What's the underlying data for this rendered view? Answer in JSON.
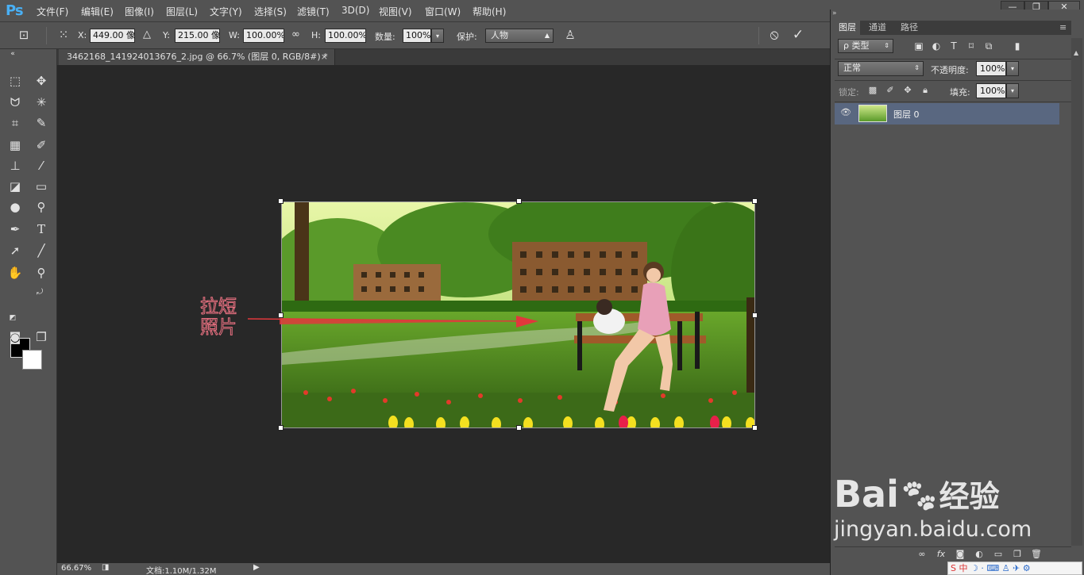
{
  "app": {
    "logo": "Ps"
  },
  "menu": [
    "文件(F)",
    "编辑(E)",
    "图像(I)",
    "图层(L)",
    "文字(Y)",
    "选择(S)",
    "滤镜(T)",
    "3D(D)",
    "视图(V)",
    "窗口(W)",
    "帮助(H)"
  ],
  "window_controls": {
    "minimize": "—",
    "restore": "❐",
    "close": "✕"
  },
  "options": {
    "x_label": "X:",
    "x_value": "449.00 像",
    "y_label": "Y:",
    "y_value": "215.00 像",
    "w_label": "W:",
    "w_value": "100.00%",
    "h_label": "H:",
    "h_value": "100.00%",
    "amount_label": "数量:",
    "amount_value": "100%",
    "protect_label": "保护:",
    "protect_value": "人物",
    "cancel_icon": "⦸",
    "commit_icon": "✓"
  },
  "document_tab": {
    "title": "3462168_141924013676_2.jpg @ 66.7% (图层 0, RGB/8#) *",
    "close": "×"
  },
  "status": {
    "zoom": "66.67%",
    "doc_info": "文档:1.10M/1.32M"
  },
  "annotation": {
    "line1": "拉短",
    "line2": "照片"
  },
  "layers_panel": {
    "tabs": [
      "图层",
      "通道",
      "路径"
    ],
    "filter_kind": "ρ 类型",
    "blend_mode": "正常",
    "opacity_label": "不透明度:",
    "opacity_value": "100%",
    "lock_label": "锁定:",
    "fill_label": "填充:",
    "fill_value": "100%",
    "layers": [
      {
        "name": "图层 0",
        "visible": true
      }
    ],
    "footer_icons": [
      "link-icon",
      "fx-icon",
      "mask-icon",
      "adjustment-icon",
      "group-icon",
      "new-layer-icon",
      "trash-icon"
    ]
  },
  "watermark": {
    "brand": "Bai",
    "brand_tail": "经验",
    "url": "jingyan.baidu.com"
  },
  "ime_bar": {
    "label": "S 中"
  },
  "colors": {
    "accent": "#49b0f5",
    "selected_layer": "#596780",
    "arrow": "#e0383c"
  }
}
